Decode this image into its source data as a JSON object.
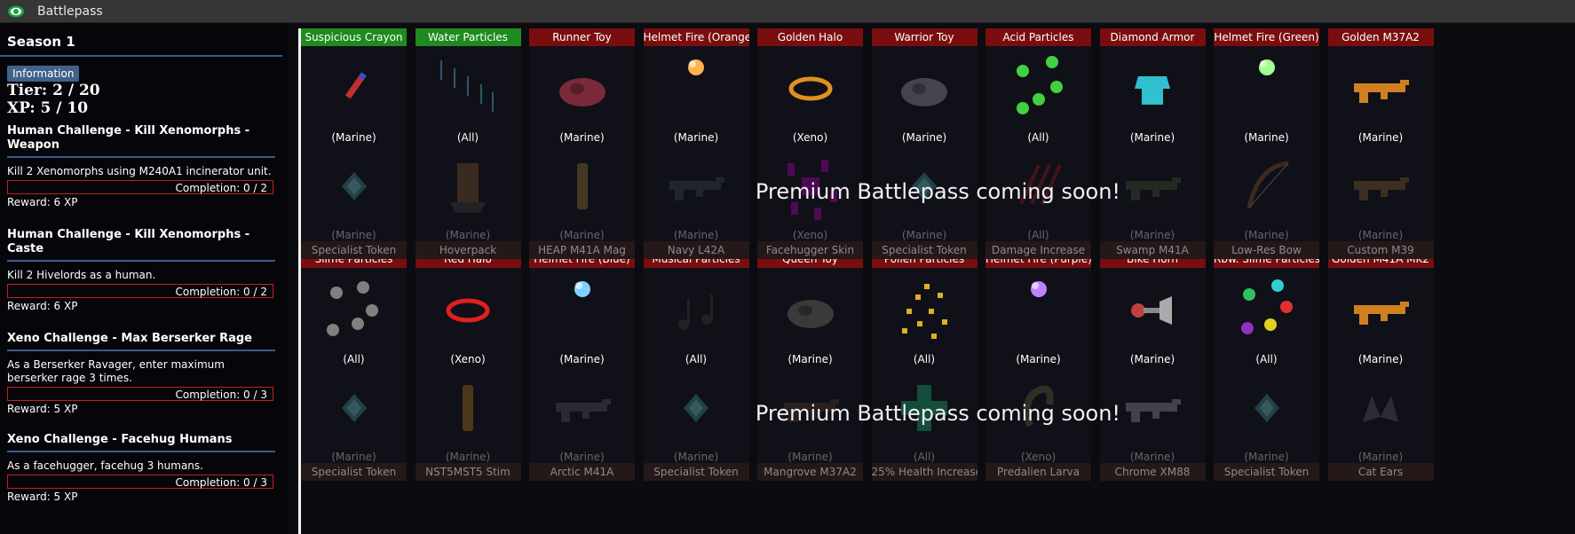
{
  "window": {
    "title": "Battlepass",
    "icon": "eye-icon"
  },
  "sidebar": {
    "season": "Season 1",
    "info_label": "Information",
    "tier": "Tier: 2 / 20",
    "xp": "XP: 5 / 10",
    "challenges": [
      {
        "title": "Human Challenge - Kill Xenomorphs - Weapon",
        "desc": "Kill 2 Xenomorphs using M240A1 incinerator unit.",
        "completion": "Completion: 0 / 2",
        "reward": "Reward: 6 XP"
      },
      {
        "title": "Human Challenge - Kill Xenomorphs - Caste",
        "desc": "Kill 2 Hivelords as a human.",
        "completion": "Completion: 0 / 2",
        "reward": "Reward: 6 XP"
      },
      {
        "title": "Xeno Challenge - Max Berserker Rage",
        "desc": "As a Berserker Ravager, enter maximum berserker rage 3 times.",
        "completion": "Completion: 0 / 3",
        "reward": "Reward: 5 XP"
      },
      {
        "title": "Xeno Challenge - Facehug Humans",
        "desc": "As a facehugger, facehug 3 humans.",
        "completion": "Completion: 0 / 3",
        "reward": "Reward: 5 XP"
      }
    ]
  },
  "premium_notice": "Premium Battlepass coming soon!",
  "free_rows": [
    [
      {
        "name": "Suspicious Crayon",
        "cat": "(Marine)",
        "num": "1",
        "state": "green",
        "icon": "crayon-icon",
        "color": "#c03030"
      },
      {
        "name": "Water Particles",
        "cat": "(All)",
        "num": "2",
        "state": "green",
        "icon": "rain-icon",
        "color": "#2a5a6a"
      },
      {
        "name": "Runner Toy",
        "cat": "(Marine)",
        "num": "3",
        "state": "red",
        "icon": "runner-toy-icon",
        "color": "#7a2a3a"
      },
      {
        "name": "Helmet Fire (Orange)",
        "cat": "(Marine)",
        "num": "4",
        "state": "red",
        "icon": "fire-orange-icon",
        "color": "#ffb050"
      },
      {
        "name": "Golden Halo",
        "cat": "(Xeno)",
        "num": "5",
        "state": "red",
        "icon": "halo-icon",
        "color": "#e09020"
      },
      {
        "name": "Warrior Toy",
        "cat": "(Marine)",
        "num": "6",
        "state": "red",
        "icon": "warrior-toy-icon",
        "color": "#444450"
      },
      {
        "name": "Acid Particles",
        "cat": "(All)",
        "num": "7",
        "state": "red",
        "icon": "acid-particles-icon",
        "color": "#40d040"
      },
      {
        "name": "Diamond Armor",
        "cat": "(Marine)",
        "num": "8",
        "state": "red",
        "icon": "armor-icon",
        "color": "#30c0d0"
      },
      {
        "name": "Helmet Fire (Green)",
        "cat": "(Marine)",
        "num": "9",
        "state": "red",
        "icon": "fire-green-icon",
        "color": "#a0ff90"
      },
      {
        "name": "Golden M37A2",
        "cat": "(Marine)",
        "num": "10",
        "state": "red",
        "icon": "shotgun-icon",
        "color": "#d08020"
      }
    ],
    [
      {
        "name": "Slime Particles",
        "cat": "(All)",
        "num": "11",
        "state": "red",
        "icon": "slime-icon",
        "color": "#808080"
      },
      {
        "name": "Red Halo",
        "cat": "(Xeno)",
        "num": "12",
        "state": "red",
        "icon": "halo-icon",
        "color": "#e02020"
      },
      {
        "name": "Helmet Fire (Blue)",
        "cat": "(Marine)",
        "num": "13",
        "state": "red",
        "icon": "fire-blue-icon",
        "color": "#80d0ff"
      },
      {
        "name": "Musical Particles",
        "cat": "(All)",
        "num": "14",
        "state": "red",
        "icon": "music-icon",
        "color": "#222222"
      },
      {
        "name": "Queen Toy",
        "cat": "(Marine)",
        "num": "15",
        "state": "red",
        "icon": "queen-toy-icon",
        "color": "#3a3a3a"
      },
      {
        "name": "Pollen Particles",
        "cat": "(All)",
        "num": "16",
        "state": "red",
        "icon": "pollen-icon",
        "color": "#e0b020"
      },
      {
        "name": "Helmet Fire (Purple)",
        "cat": "(Marine)",
        "num": "17",
        "state": "red",
        "icon": "fire-purple-icon",
        "color": "#c080ff"
      },
      {
        "name": "Bike Horn",
        "cat": "(Marine)",
        "num": "18",
        "state": "red",
        "icon": "horn-icon",
        "color": "#c04040"
      },
      {
        "name": "Rbw. Slime Particles",
        "cat": "(All)",
        "num": "19",
        "state": "red",
        "icon": "rainbow-slime-icon",
        "color": "#e03030"
      },
      {
        "name": "Golden M41A MK2",
        "cat": "(Marine)",
        "num": "20",
        "state": "red",
        "icon": "rifle-icon",
        "color": "#d08020"
      }
    ]
  ],
  "premium_rows": [
    [
      {
        "name": "Specialist Token",
        "cat": "(Marine)",
        "icon": "token-icon",
        "color": "#40a0a0"
      },
      {
        "name": "Hoverpack",
        "cat": "(Marine)",
        "icon": "hoverpack-icon",
        "color": "#8a5a30"
      },
      {
        "name": "HEAP M41A Mag",
        "cat": "(Marine)",
        "icon": "magazine-icon",
        "color": "#a08030"
      },
      {
        "name": "Navy L42A",
        "cat": "(Marine)",
        "icon": "rifle-icon",
        "color": "#404a5a"
      },
      {
        "name": "Facehugger Skin",
        "cat": "(Xeno)",
        "icon": "facehugger-icon",
        "color": "#c000c0"
      },
      {
        "name": "Specialist Token",
        "cat": "(Marine)",
        "icon": "token-icon",
        "color": "#40a0a0"
      },
      {
        "name": "Damage Increase",
        "cat": "(All)",
        "icon": "claw-icon",
        "color": "#a02020"
      },
      {
        "name": "Swamp M41A",
        "cat": "(Marine)",
        "icon": "rifle-icon",
        "color": "#4a5a3a"
      },
      {
        "name": "Low-Res Bow",
        "cat": "(Marine)",
        "icon": "bow-icon",
        "color": "#8a5a30"
      },
      {
        "name": "Custom M39",
        "cat": "(Marine)",
        "icon": "smg-icon",
        "color": "#8a6a30"
      }
    ],
    [
      {
        "name": "Specialist Token",
        "cat": "(Marine)",
        "icon": "token-icon",
        "color": "#40a0a0"
      },
      {
        "name": "NST5MST5 Stim",
        "cat": "(Marine)",
        "icon": "stim-icon",
        "color": "#c08020"
      },
      {
        "name": "Arctic M41A",
        "cat": "(Marine)",
        "icon": "rifle-icon",
        "color": "#5a5a6a"
      },
      {
        "name": "Specialist Token",
        "cat": "(Marine)",
        "icon": "token-icon",
        "color": "#40a0a0"
      },
      {
        "name": "Mangrove M37A2",
        "cat": "(Marine)",
        "icon": "shotgun-icon",
        "color": "#5a3a2a"
      },
      {
        "name": "25% Health Increase",
        "cat": "(All)",
        "icon": "health-icon",
        "color": "#20c080"
      },
      {
        "name": "Predalien Larva",
        "cat": "(Xeno)",
        "icon": "larva-icon",
        "color": "#6a6a3a"
      },
      {
        "name": "Chrome XM88",
        "cat": "(Marine)",
        "icon": "rifle-icon",
        "color": "#a0a0b0"
      },
      {
        "name": "Specialist Token",
        "cat": "(Marine)",
        "icon": "token-icon",
        "color": "#40a0a0"
      },
      {
        "name": "Cat Ears",
        "cat": "(Marine)",
        "icon": "cat-ears-icon",
        "color": "#606070"
      }
    ]
  ]
}
